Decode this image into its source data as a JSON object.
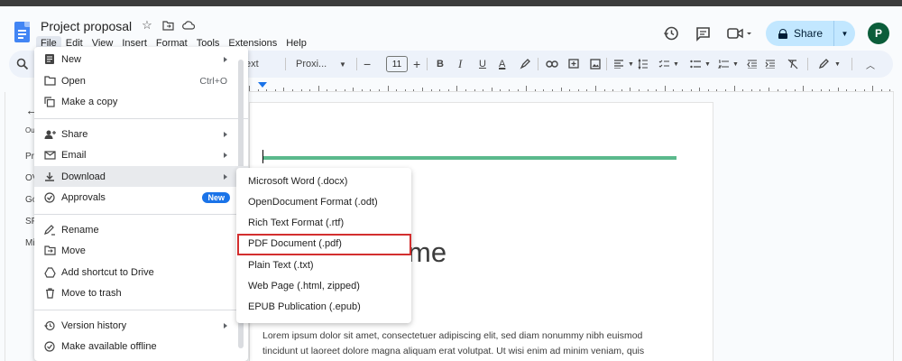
{
  "doc": {
    "title": "Project proposal",
    "avatar_letter": "P",
    "share_label": "Share"
  },
  "menubar": [
    "File",
    "Edit",
    "View",
    "Insert",
    "Format",
    "Tools",
    "Extensions",
    "Help"
  ],
  "toolbar": {
    "style_partial": "ext",
    "font_name": "Proxi...",
    "font_size": "11"
  },
  "outline": {
    "label_partial": "Ou",
    "items": [
      "Pr",
      "OV",
      "Go",
      "SP",
      "Mi"
    ]
  },
  "file_menu": {
    "items": [
      {
        "label": "New",
        "icon": "new-doc-icon",
        "submenu": true
      },
      {
        "label": "Open",
        "icon": "folder-open-icon",
        "shortcut": "Ctrl+O"
      },
      {
        "label": "Make a copy",
        "icon": "copy-icon"
      },
      {
        "label": "Share",
        "icon": "person-add-icon",
        "submenu": true
      },
      {
        "label": "Email",
        "icon": "email-icon",
        "submenu": true
      },
      {
        "label": "Download",
        "icon": "download-icon",
        "submenu": true,
        "highlighted": true
      },
      {
        "label": "Approvals",
        "icon": "approvals-icon",
        "badge": "New"
      },
      {
        "label": "Rename",
        "icon": "rename-icon"
      },
      {
        "label": "Move",
        "icon": "move-icon"
      },
      {
        "label": "Add shortcut to Drive",
        "icon": "drive-shortcut-icon"
      },
      {
        "label": "Move to trash",
        "icon": "trash-icon"
      },
      {
        "label": "Version history",
        "icon": "history-icon",
        "submenu": true
      },
      {
        "label": "Make available offline",
        "icon": "offline-icon"
      }
    ]
  },
  "download_submenu": {
    "items": [
      "Microsoft Word (.docx)",
      "OpenDocument Format (.odt)",
      "Rich Text Format (.rtf)",
      "PDF Document (.pdf)",
      "Plain Text (.txt)",
      "Web Page (.html, zipped)",
      "EPUB Publication (.epub)"
    ],
    "highlighted_index": 3
  },
  "page": {
    "title_partial": "me",
    "body_text": "Lorem ipsum dolor sit amet, consectetuer adipiscing elit, sed diam nonummy nibh euismod tincidunt ut laoreet dolore magna aliquam erat volutpat. Ut wisi enim ad minim veniam, quis"
  },
  "colors": {
    "accent_blue": "#1a73e8",
    "share_bg": "#c2e7ff",
    "highlight_red": "#d32f2f",
    "heading_line": "#5bb98c",
    "avatar_bg": "#0b5d3a"
  }
}
